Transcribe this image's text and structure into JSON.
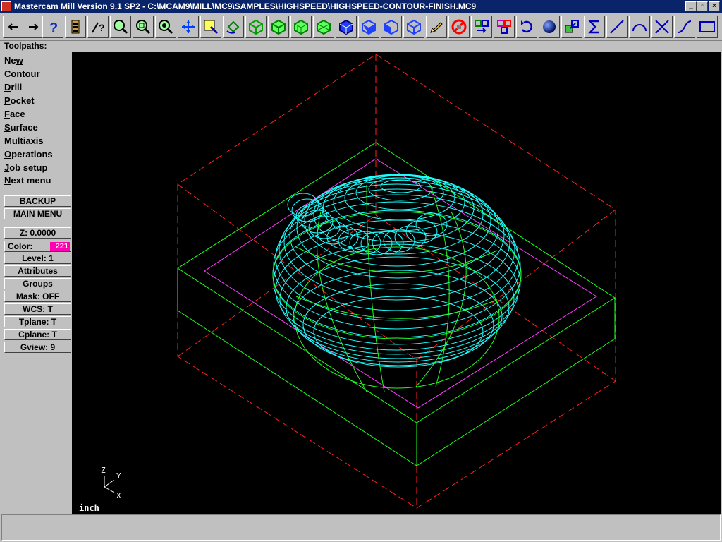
{
  "window": {
    "title": "Mastercam Mill Version 9.1 SP2 - C:\\MCAM9\\MILL\\MC9\\SAMPLES\\HIGHSPEED\\HIGHSPEED-CONTOUR-FINISH.MC9",
    "minimize": "_",
    "maximize": "▫",
    "close": "×"
  },
  "toolbar": {
    "buttons": [
      {
        "icon": "arrow-left-icon",
        "glyph": "←"
      },
      {
        "icon": "arrow-right-icon",
        "glyph": "→"
      },
      {
        "icon": "help-icon",
        "glyph": "?"
      },
      {
        "icon": "battery-icon",
        "glyph": ""
      },
      {
        "icon": "analyze-icon",
        "glyph": "?"
      },
      {
        "icon": "zoom-window-icon",
        "glyph": ""
      },
      {
        "icon": "zoom-out-icon",
        "glyph": ""
      },
      {
        "icon": "zoom-target-icon",
        "glyph": ""
      },
      {
        "icon": "pan-icon",
        "glyph": ""
      },
      {
        "icon": "select-icon",
        "glyph": ""
      },
      {
        "icon": "rotate-view-icon",
        "glyph": ""
      },
      {
        "icon": "view-top-icon",
        "glyph": ""
      },
      {
        "icon": "view-front-icon",
        "glyph": ""
      },
      {
        "icon": "view-side-icon",
        "glyph": ""
      },
      {
        "icon": "view-iso-icon",
        "glyph": ""
      },
      {
        "icon": "cplane-top-icon",
        "glyph": ""
      },
      {
        "icon": "cplane-front-icon",
        "glyph": ""
      },
      {
        "icon": "cplane-side-icon",
        "glyph": ""
      },
      {
        "icon": "cplane-3d-icon",
        "glyph": ""
      },
      {
        "icon": "pencil-icon",
        "glyph": ""
      },
      {
        "icon": "no-delete-icon",
        "glyph": ""
      },
      {
        "icon": "transform-icon",
        "glyph": ""
      },
      {
        "icon": "transform-copy-icon",
        "glyph": ""
      },
      {
        "icon": "undo-icon",
        "glyph": "↶"
      },
      {
        "icon": "shade-sphere-icon",
        "glyph": ""
      },
      {
        "icon": "backplot-icon",
        "glyph": ""
      },
      {
        "icon": "sum-icon",
        "glyph": "Σ"
      },
      {
        "icon": "line-icon",
        "glyph": ""
      },
      {
        "icon": "arc-icon",
        "glyph": ""
      },
      {
        "icon": "fillet-icon",
        "glyph": ""
      },
      {
        "icon": "spline-icon",
        "glyph": ""
      },
      {
        "icon": "rectangle-icon",
        "glyph": ""
      }
    ]
  },
  "prompt": "Toolpaths:",
  "menu": [
    {
      "pre": "Ne",
      "u": "w",
      "post": ""
    },
    {
      "pre": "",
      "u": "C",
      "post": "ontour"
    },
    {
      "pre": "",
      "u": "D",
      "post": "rill"
    },
    {
      "pre": "",
      "u": "P",
      "post": "ocket"
    },
    {
      "pre": "",
      "u": "F",
      "post": "ace"
    },
    {
      "pre": "",
      "u": "S",
      "post": "urface"
    },
    {
      "pre": "Multi",
      "u": "a",
      "post": "xis"
    },
    {
      "pre": "",
      "u": "O",
      "post": "perations"
    },
    {
      "pre": "",
      "u": "J",
      "post": "ob setup"
    },
    {
      "pre": "",
      "u": "N",
      "post": "ext menu"
    }
  ],
  "nav_buttons": {
    "backup": "BACKUP",
    "main_menu": "MAIN MENU"
  },
  "secondary": {
    "z": "Z:  0.0000",
    "color_label": "Color:",
    "color_value": "221",
    "level": "Level:  1",
    "attributes": "Attributes",
    "groups": "Groups",
    "mask": "Mask:  OFF",
    "wcs": "WCS:   T",
    "tplane": "Tplane:  T",
    "cplane": "Cplane:  T",
    "gview": "Gview:  9"
  },
  "axes": {
    "z": "Z",
    "y": "Y",
    "x": "X"
  },
  "units": "inch",
  "colors": {
    "titlebar": "#0a246a",
    "stock": "#ff2020",
    "part": "#20ff20",
    "boundary": "#ff40ff",
    "toolpath": "#20ffff",
    "viewport_bg": "#000000"
  }
}
